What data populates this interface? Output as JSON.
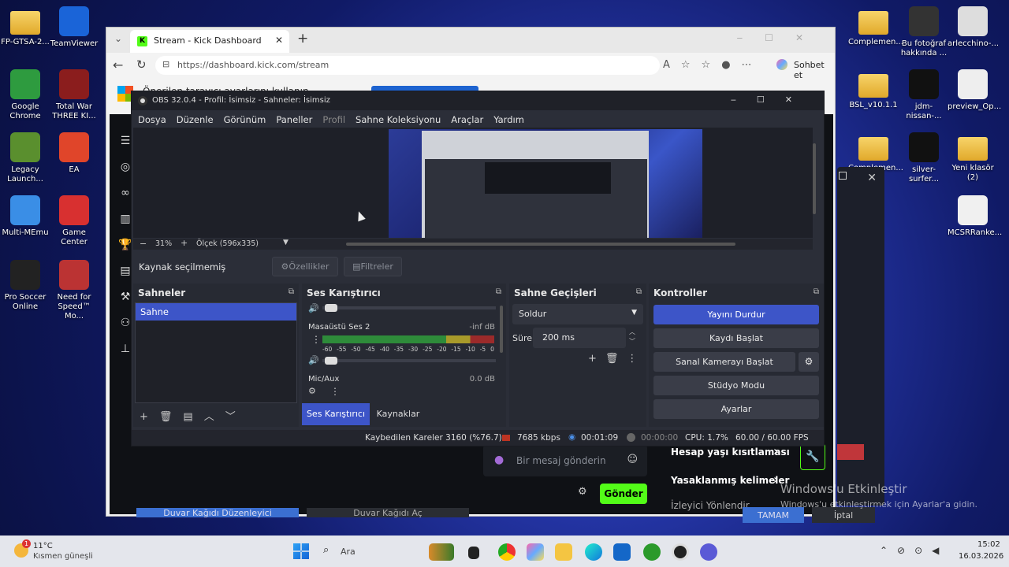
{
  "desktop_left": [
    {
      "label": "FP-GTSA-2...",
      "kind": "folder"
    },
    {
      "label": "TeamViewer",
      "kind": "app",
      "color": "#1a64d8"
    },
    {
      "label": "Google Chrome",
      "kind": "app",
      "color": "#2e9b3f"
    },
    {
      "label": "Total War THREE KI...",
      "kind": "app",
      "color": "#8b1d1d"
    },
    {
      "label": "Legacy Launch...",
      "kind": "app",
      "color": "#5a8f2e"
    },
    {
      "label": "EA",
      "kind": "app",
      "color": "#e0452a"
    },
    {
      "label": "Multi-MEmu",
      "kind": "app",
      "color": "#3a8ee6"
    },
    {
      "label": "Game Center",
      "kind": "app",
      "color": "#d83030"
    },
    {
      "label": "Pro Soccer Online",
      "kind": "app",
      "color": "#222"
    },
    {
      "label": "Need for Speed™ Mo...",
      "kind": "app",
      "color": "#b33"
    }
  ],
  "desktop_right": [
    {
      "label": "Complemen...",
      "kind": "folder"
    },
    {
      "label": "Bu fotoğraf hakkında ...",
      "kind": "app",
      "color": "#333"
    },
    {
      "label": "arlecchino-...",
      "kind": "app",
      "color": "#ddd"
    },
    {
      "label": "BSL_v10.1.1",
      "kind": "folder"
    },
    {
      "label": "jdm-nissan-...",
      "kind": "app",
      "color": "#111"
    },
    {
      "label": "preview_Op...",
      "kind": "app",
      "color": "#eee"
    },
    {
      "label": "Complemen...",
      "kind": "folder"
    },
    {
      "label": "silver-surfer...",
      "kind": "app",
      "color": "#111"
    },
    {
      "label": "Yeni klasör (2)",
      "kind": "folder"
    },
    {
      "label": "MCSRRanke...",
      "kind": "app",
      "color": "#f0f0f0"
    }
  ],
  "browser": {
    "tab_title": "Stream - Kick Dashboard",
    "url": "https://dashboard.kick.com/stream",
    "sohbet": "Sohbet et",
    "notice": "Önerilen tarayıcı ayarlarını kullanın",
    "chat_placeholder": "Bir mesaj gönderin",
    "send": "Gönder",
    "hesap": "Hesap yaşı kısıtlaması",
    "yasak": "Yasaklanmış kelimeler",
    "izleyici": "İzleyici Yönlendir",
    "duvar1": "Duvar Kağıdı Düzenleyici",
    "duvar2": "Duvar Kağıdı Aç",
    "tamam": "TAMAM",
    "iptal": "İptal"
  },
  "obs": {
    "title": "OBS 32.0.4 - Profil: İsimsiz - Sahneler: İsimsiz",
    "menu": [
      "Dosya",
      "Düzenle",
      "Görünüm",
      "Paneller",
      "Profil",
      "Sahne Koleksiyonu",
      "Araçlar",
      "Yardım"
    ],
    "zoom": "31%",
    "scale": "Ölçek (596x335)",
    "no_source": "Kaynak seçilmemiş",
    "props": "Özellikler",
    "filters": "Filtreler",
    "scenes_title": "Sahneler",
    "scene_item": "Sahne",
    "mixer_title": "Ses Karıştırıcı",
    "desktop_audio": "Masaüstü Ses 2",
    "desktop_db": "-inf dB",
    "mic": "Mic/Aux",
    "mic_db": "0.0 dB",
    "meter_ticks": [
      "-60",
      "-55",
      "-50",
      "-45",
      "-40",
      "-35",
      "-30",
      "-25",
      "-20",
      "-15",
      "-10",
      "-5",
      "0"
    ],
    "tab_mixer": "Ses Karıştırıcı",
    "tab_sources": "Kaynaklar",
    "transitions_title": "Sahne Geçişleri",
    "transition": "Soldur",
    "duration_label": "Süre",
    "duration": "200 ms",
    "controls_title": "Kontroller",
    "ctrl_stop": "Yayını Durdur",
    "ctrl_rec": "Kaydı Başlat",
    "ctrl_vcam": "Sanal Kamerayı Başlat",
    "ctrl_studio": "Stüdyo Modu",
    "ctrl_settings": "Ayarlar",
    "status_dropped": "Kaybedilen Kareler 3160 (%76.7)",
    "status_kbps": "7685 kbps",
    "status_stream": "00:01:09",
    "status_rec": "00:00:00",
    "status_cpu": "CPU: 1.7%",
    "status_fps": "60.00 / 60.00 FPS"
  },
  "watermark": {
    "line1": "Windows'u Etkinleştir",
    "line2": "Windows'u etkinleştirmek için Ayarlar'a gidin."
  },
  "taskbar": {
    "temp": "11°C",
    "weather": "Kısmen güneşli",
    "search": "Ara",
    "time": "15:02",
    "date": "16.03.2026",
    "badge": "1"
  },
  "colors": {
    "obs_bg": "#2b2e38",
    "obs_panel": "#272a33",
    "accent": "#3d55c8",
    "kick_green": "#53fc18"
  }
}
